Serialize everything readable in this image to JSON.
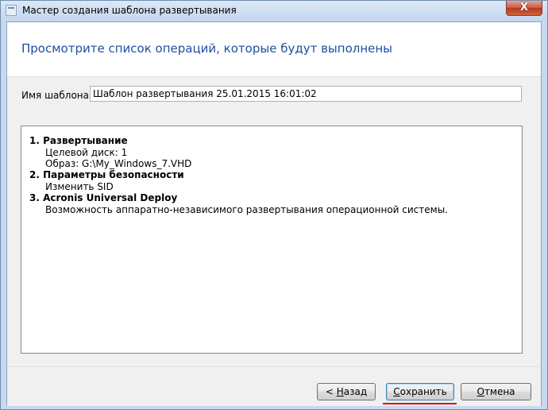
{
  "window": {
    "title": "Мастер создания шаблона развертывания",
    "close_glyph": "X"
  },
  "header": {
    "title": "Просмотрите список операций, которые будут выполнены"
  },
  "template_name": {
    "label": "Имя шаблона:",
    "value": "Шаблон развертывания 25.01.2015 16:01:02"
  },
  "operations": [
    {
      "title": "1. Развертывание",
      "details": [
        "Целевой диск: 1",
        "Образ: G:\\My_Windows_7.VHD"
      ]
    },
    {
      "title": "2. Параметры безопасности",
      "details": [
        "Изменить SID"
      ]
    },
    {
      "title": "3. Acronis Universal Deploy",
      "details": [
        "Возможность аппаратно-независимого развертывания операционной системы."
      ]
    }
  ],
  "buttons": {
    "back_arrow": "<",
    "back_label": "Назад",
    "save_label": "Сохранить",
    "cancel_label": "Отмена"
  },
  "annotation": {
    "highlight_color": "#e0000f"
  },
  "colors": {
    "header_title": "#1e4fa0",
    "title_bar": "#c7d9ee",
    "close_button": "#c9583f"
  }
}
